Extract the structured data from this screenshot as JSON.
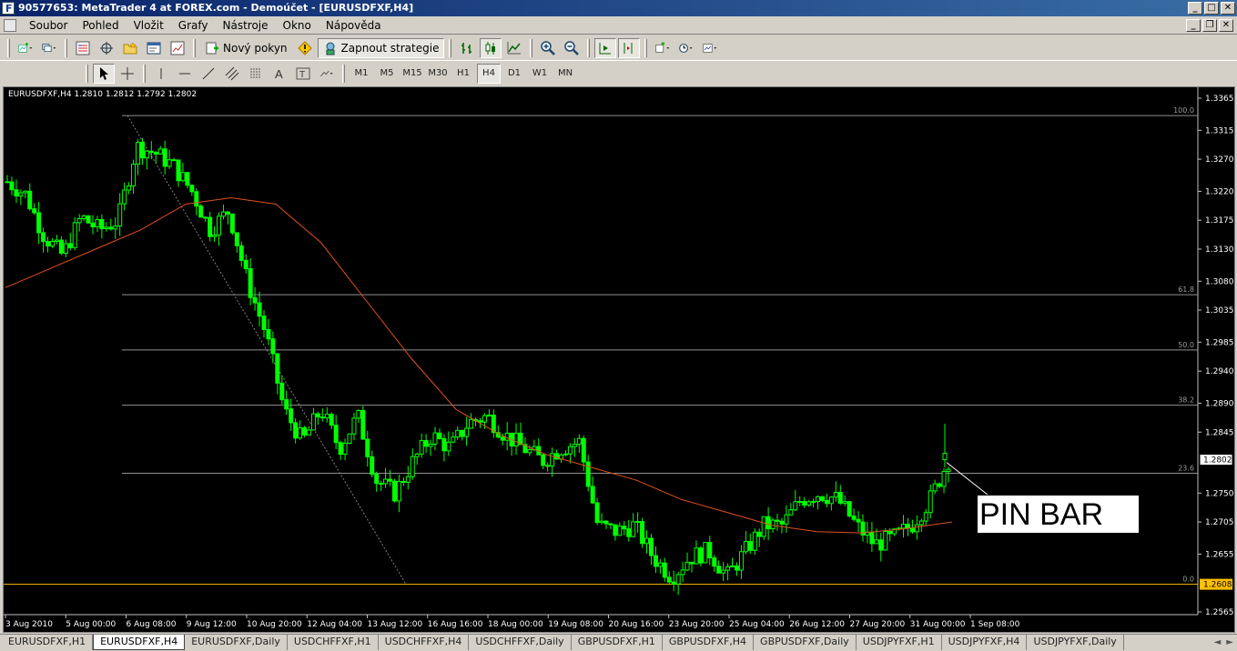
{
  "window": {
    "title": "90577653: MetaTrader 4 at FOREX.com - Demoúčet - [EURUSDFXF,H4]"
  },
  "menu": {
    "items": [
      "Soubor",
      "Pohled",
      "Vložit",
      "Grafy",
      "Nástroje",
      "Okno",
      "Nápověda"
    ]
  },
  "toolbar": {
    "new_order_label": "Nový pokyn",
    "strategy_label": "Zapnout strategie",
    "timeframes": [
      "M1",
      "M5",
      "M15",
      "M30",
      "H1",
      "H4",
      "D1",
      "W1",
      "MN"
    ],
    "active_timeframe": "H4"
  },
  "chart": {
    "header": "EURUSDFXF,H4  1.2810 1.2812 1.2792 1.2802",
    "current_price_label": "1.2802",
    "fib_level_price_label": "1.2608",
    "annotation": "PIN BAR",
    "colors": {
      "bull_candle": "#00ff00",
      "ma_line": "#e05020",
      "fib_line": "#909090",
      "base_line": "#ffc000",
      "trend_line": "#808080"
    }
  },
  "tabs": {
    "items": [
      "EURUSDFXF,H1",
      "EURUSDFXF,H4",
      "EURUSDFXF,Daily",
      "USDCHFFXF,H1",
      "USDCHFFXF,H4",
      "USDCHFFXF,Daily",
      "GBPUSDFXF,H1",
      "GBPUSDFXF,H4",
      "GBPUSDFXF,Daily",
      "USDJPYFXF,H1",
      "USDJPYFXF,H4",
      "USDJPYFXF,Daily"
    ],
    "active": "EURUSDFXF,H4"
  },
  "chart_data": {
    "type": "candlestick",
    "symbol": "EURUSDFXF",
    "timeframe": "H4",
    "ylim": [
      1.2565,
      1.3365
    ],
    "y_ticks": [
      1.3365,
      1.3315,
      1.327,
      1.322,
      1.3175,
      1.313,
      1.308,
      1.3035,
      1.2985,
      1.294,
      1.289,
      1.2845,
      1.2802,
      1.275,
      1.2705,
      1.2655,
      1.2608,
      1.2565
    ],
    "x_ticks": [
      "3 Aug 2010",
      "5 Aug 00:00",
      "6 Aug 08:00",
      "9 Aug 12:00",
      "10 Aug 20:00",
      "12 Aug 04:00",
      "13 Aug 12:00",
      "16 Aug 16:00",
      "18 Aug 00:00",
      "19 Aug 08:00",
      "20 Aug 16:00",
      "23 Aug 20:00",
      "25 Aug 04:00",
      "26 Aug 12:00",
      "27 Aug 20:00",
      "31 Aug 00:00",
      "1 Sep 08:00"
    ],
    "fibonacci_levels": [
      {
        "label": "100.0",
        "price": 1.3338
      },
      {
        "label": "61.8",
        "price": 1.3059
      },
      {
        "label": "50.0",
        "price": 1.2973
      },
      {
        "label": "38.2",
        "price": 1.2887
      },
      {
        "label": "23.6",
        "price": 1.2781
      },
      {
        "label": "0.0",
        "price": 1.2608
      }
    ],
    "current_price": 1.2802,
    "close_path": [
      1.3235,
      1.3215,
      1.315,
      1.312,
      1.318,
      1.316,
      1.3175,
      1.329,
      1.328,
      1.326,
      1.322,
      1.316,
      1.319,
      1.308,
      1.3,
      1.288,
      1.283,
      1.288,
      1.282,
      1.287,
      1.277,
      1.275,
      1.28,
      1.284,
      1.282,
      1.286,
      1.287,
      1.284,
      1.282,
      1.28,
      1.282,
      1.283,
      1.27,
      1.269,
      1.27,
      1.265,
      1.262,
      1.265,
      1.266,
      1.262,
      1.266,
      1.27,
      1.27,
      1.274,
      1.275,
      1.274,
      1.27,
      1.267,
      1.268,
      1.27,
      1.274,
      1.2802
    ],
    "moving_average_path": [
      1.307,
      1.31,
      1.313,
      1.316,
      1.32,
      1.321,
      1.32,
      1.314,
      1.305,
      1.296,
      1.288,
      1.284,
      1.281,
      1.279,
      1.277,
      1.274,
      1.272,
      1.27,
      1.269,
      1.2688,
      1.2695,
      1.2705
    ]
  }
}
